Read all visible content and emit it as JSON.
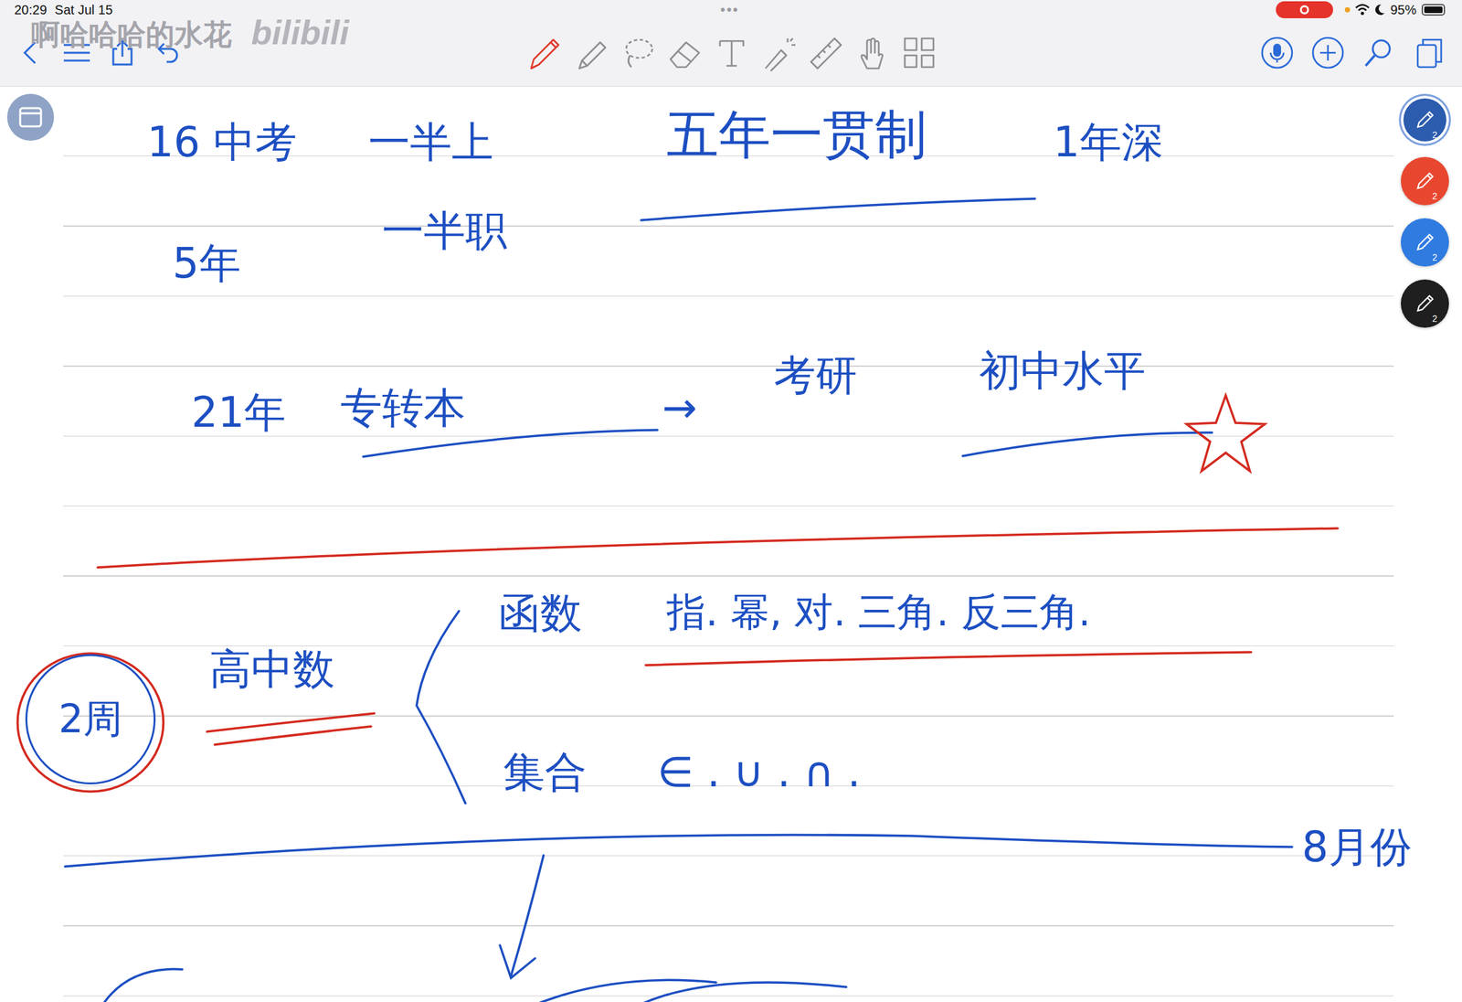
{
  "status_bar": {
    "time": "20:29",
    "date": "Sat Jul 15",
    "menu_dots": "•••",
    "battery": "95%",
    "battery_level": 0.95,
    "recording": true
  },
  "watermark": {
    "channel": "啊哈哈哈的水花",
    "logo": "bilibili"
  },
  "toolbar": {
    "left": [
      {
        "kind": "back"
      },
      {
        "kind": "list"
      },
      {
        "kind": "share"
      },
      {
        "kind": "undo"
      }
    ],
    "tools": [
      {
        "kind": "pen",
        "selected": true
      },
      {
        "kind": "highlighter",
        "selected": false
      },
      {
        "kind": "lasso",
        "selected": false
      },
      {
        "kind": "eraser",
        "selected": false
      },
      {
        "kind": "text",
        "selected": false
      },
      {
        "kind": "laser",
        "selected": false
      },
      {
        "kind": "ruler",
        "selected": false
      },
      {
        "kind": "hand",
        "selected": false
      },
      {
        "kind": "media",
        "selected": false
      }
    ],
    "right": [
      {
        "kind": "mic"
      },
      {
        "kind": "add"
      },
      {
        "kind": "search"
      },
      {
        "kind": "pages"
      }
    ]
  },
  "pens": [
    {
      "color": "#2b5cad",
      "size": "2",
      "selected": true
    },
    {
      "color": "#e8472f",
      "size": "2",
      "selected": false
    },
    {
      "color": "#2f7be0",
      "size": "2",
      "selected": false
    },
    {
      "color": "#1f1f1f",
      "size": "2",
      "selected": false
    }
  ],
  "notes": [
    {
      "text": "16 中考",
      "color": "#1d4fc2"
    },
    {
      "text": "一半上",
      "color": "#1d4fc2"
    },
    {
      "text": "五年一贯制",
      "color": "#1d4fc2"
    },
    {
      "text": "1年深",
      "color": "#1d4fc2"
    },
    {
      "text": "5年",
      "color": "#1d4fc2"
    },
    {
      "text": "一半职",
      "color": "#1d4fc2"
    },
    {
      "text": "21年",
      "color": "#1d4fc2"
    },
    {
      "text": "专转本",
      "color": "#1d4fc2"
    },
    {
      "text": "→",
      "color": "#1d4fc2"
    },
    {
      "text": "考研",
      "color": "#1d4fc2"
    },
    {
      "text": "初中水平",
      "color": "#1d4fc2"
    },
    {
      "text": "高中数",
      "color": "#1d4fc2"
    },
    {
      "text": "函数",
      "color": "#1d4fc2"
    },
    {
      "text": "指. 幂, 对. 三角. 反三角.",
      "color": "#1d4fc2"
    },
    {
      "text": "集合",
      "color": "#1d4fc2"
    },
    {
      "text": "∈ . ∪ . ∩ .",
      "color": "#1d4fc2"
    },
    {
      "text": "8月份",
      "color": "#1d4fc2"
    }
  ],
  "badge": {
    "text": "2周"
  }
}
